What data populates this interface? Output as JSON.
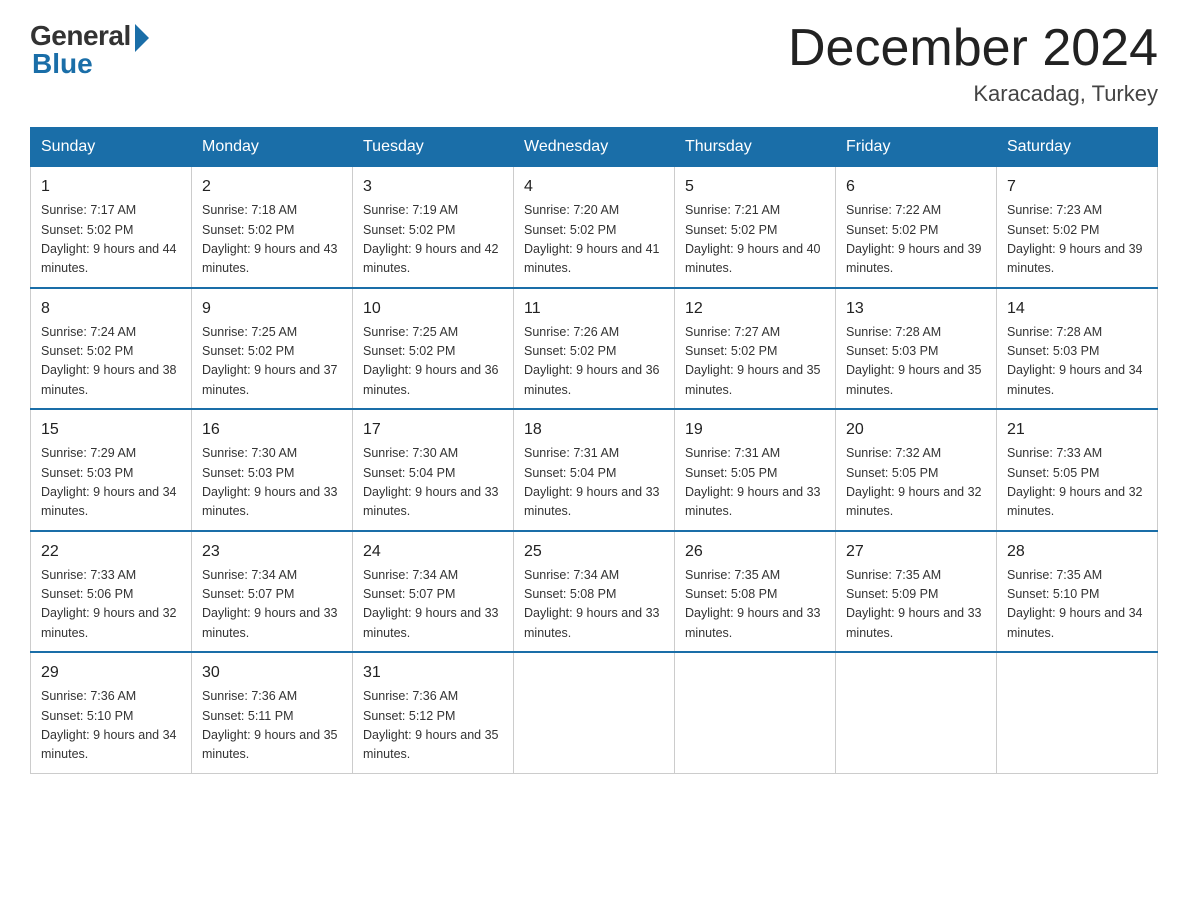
{
  "header": {
    "logo_general": "General",
    "logo_blue": "Blue",
    "month_title": "December 2024",
    "location": "Karacadag, Turkey"
  },
  "days_of_week": [
    "Sunday",
    "Monday",
    "Tuesday",
    "Wednesday",
    "Thursday",
    "Friday",
    "Saturday"
  ],
  "weeks": [
    [
      {
        "day": "1",
        "sunrise": "Sunrise: 7:17 AM",
        "sunset": "Sunset: 5:02 PM",
        "daylight": "Daylight: 9 hours and 44 minutes."
      },
      {
        "day": "2",
        "sunrise": "Sunrise: 7:18 AM",
        "sunset": "Sunset: 5:02 PM",
        "daylight": "Daylight: 9 hours and 43 minutes."
      },
      {
        "day": "3",
        "sunrise": "Sunrise: 7:19 AM",
        "sunset": "Sunset: 5:02 PM",
        "daylight": "Daylight: 9 hours and 42 minutes."
      },
      {
        "day": "4",
        "sunrise": "Sunrise: 7:20 AM",
        "sunset": "Sunset: 5:02 PM",
        "daylight": "Daylight: 9 hours and 41 minutes."
      },
      {
        "day": "5",
        "sunrise": "Sunrise: 7:21 AM",
        "sunset": "Sunset: 5:02 PM",
        "daylight": "Daylight: 9 hours and 40 minutes."
      },
      {
        "day": "6",
        "sunrise": "Sunrise: 7:22 AM",
        "sunset": "Sunset: 5:02 PM",
        "daylight": "Daylight: 9 hours and 39 minutes."
      },
      {
        "day": "7",
        "sunrise": "Sunrise: 7:23 AM",
        "sunset": "Sunset: 5:02 PM",
        "daylight": "Daylight: 9 hours and 39 minutes."
      }
    ],
    [
      {
        "day": "8",
        "sunrise": "Sunrise: 7:24 AM",
        "sunset": "Sunset: 5:02 PM",
        "daylight": "Daylight: 9 hours and 38 minutes."
      },
      {
        "day": "9",
        "sunrise": "Sunrise: 7:25 AM",
        "sunset": "Sunset: 5:02 PM",
        "daylight": "Daylight: 9 hours and 37 minutes."
      },
      {
        "day": "10",
        "sunrise": "Sunrise: 7:25 AM",
        "sunset": "Sunset: 5:02 PM",
        "daylight": "Daylight: 9 hours and 36 minutes."
      },
      {
        "day": "11",
        "sunrise": "Sunrise: 7:26 AM",
        "sunset": "Sunset: 5:02 PM",
        "daylight": "Daylight: 9 hours and 36 minutes."
      },
      {
        "day": "12",
        "sunrise": "Sunrise: 7:27 AM",
        "sunset": "Sunset: 5:02 PM",
        "daylight": "Daylight: 9 hours and 35 minutes."
      },
      {
        "day": "13",
        "sunrise": "Sunrise: 7:28 AM",
        "sunset": "Sunset: 5:03 PM",
        "daylight": "Daylight: 9 hours and 35 minutes."
      },
      {
        "day": "14",
        "sunrise": "Sunrise: 7:28 AM",
        "sunset": "Sunset: 5:03 PM",
        "daylight": "Daylight: 9 hours and 34 minutes."
      }
    ],
    [
      {
        "day": "15",
        "sunrise": "Sunrise: 7:29 AM",
        "sunset": "Sunset: 5:03 PM",
        "daylight": "Daylight: 9 hours and 34 minutes."
      },
      {
        "day": "16",
        "sunrise": "Sunrise: 7:30 AM",
        "sunset": "Sunset: 5:03 PM",
        "daylight": "Daylight: 9 hours and 33 minutes."
      },
      {
        "day": "17",
        "sunrise": "Sunrise: 7:30 AM",
        "sunset": "Sunset: 5:04 PM",
        "daylight": "Daylight: 9 hours and 33 minutes."
      },
      {
        "day": "18",
        "sunrise": "Sunrise: 7:31 AM",
        "sunset": "Sunset: 5:04 PM",
        "daylight": "Daylight: 9 hours and 33 minutes."
      },
      {
        "day": "19",
        "sunrise": "Sunrise: 7:31 AM",
        "sunset": "Sunset: 5:05 PM",
        "daylight": "Daylight: 9 hours and 33 minutes."
      },
      {
        "day": "20",
        "sunrise": "Sunrise: 7:32 AM",
        "sunset": "Sunset: 5:05 PM",
        "daylight": "Daylight: 9 hours and 32 minutes."
      },
      {
        "day": "21",
        "sunrise": "Sunrise: 7:33 AM",
        "sunset": "Sunset: 5:05 PM",
        "daylight": "Daylight: 9 hours and 32 minutes."
      }
    ],
    [
      {
        "day": "22",
        "sunrise": "Sunrise: 7:33 AM",
        "sunset": "Sunset: 5:06 PM",
        "daylight": "Daylight: 9 hours and 32 minutes."
      },
      {
        "day": "23",
        "sunrise": "Sunrise: 7:34 AM",
        "sunset": "Sunset: 5:07 PM",
        "daylight": "Daylight: 9 hours and 33 minutes."
      },
      {
        "day": "24",
        "sunrise": "Sunrise: 7:34 AM",
        "sunset": "Sunset: 5:07 PM",
        "daylight": "Daylight: 9 hours and 33 minutes."
      },
      {
        "day": "25",
        "sunrise": "Sunrise: 7:34 AM",
        "sunset": "Sunset: 5:08 PM",
        "daylight": "Daylight: 9 hours and 33 minutes."
      },
      {
        "day": "26",
        "sunrise": "Sunrise: 7:35 AM",
        "sunset": "Sunset: 5:08 PM",
        "daylight": "Daylight: 9 hours and 33 minutes."
      },
      {
        "day": "27",
        "sunrise": "Sunrise: 7:35 AM",
        "sunset": "Sunset: 5:09 PM",
        "daylight": "Daylight: 9 hours and 33 minutes."
      },
      {
        "day": "28",
        "sunrise": "Sunrise: 7:35 AM",
        "sunset": "Sunset: 5:10 PM",
        "daylight": "Daylight: 9 hours and 34 minutes."
      }
    ],
    [
      {
        "day": "29",
        "sunrise": "Sunrise: 7:36 AM",
        "sunset": "Sunset: 5:10 PM",
        "daylight": "Daylight: 9 hours and 34 minutes."
      },
      {
        "day": "30",
        "sunrise": "Sunrise: 7:36 AM",
        "sunset": "Sunset: 5:11 PM",
        "daylight": "Daylight: 9 hours and 35 minutes."
      },
      {
        "day": "31",
        "sunrise": "Sunrise: 7:36 AM",
        "sunset": "Sunset: 5:12 PM",
        "daylight": "Daylight: 9 hours and 35 minutes."
      },
      null,
      null,
      null,
      null
    ]
  ]
}
